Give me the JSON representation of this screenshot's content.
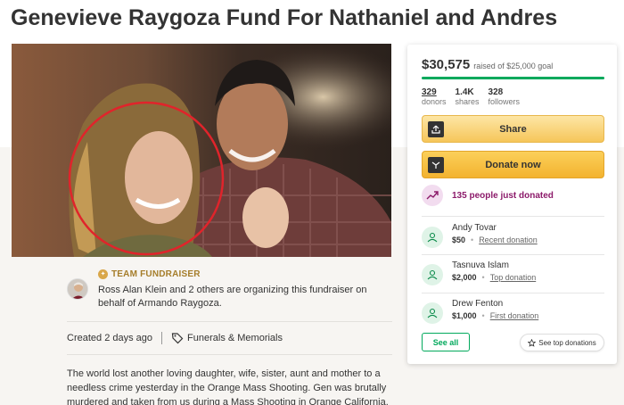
{
  "page": {
    "title": "Genevieve Raygoza Fund For Nathaniel and Andres"
  },
  "organizer": {
    "badge": "TEAM FUNDRAISER",
    "text": "Ross Alan Klein and 2 others are organizing this fundraiser on behalf of Armando Raygoza."
  },
  "meta": {
    "created": "Created 2 days ago",
    "category": "Funerals & Memorials"
  },
  "story": {
    "text": "The world lost another loving  daughter, wife, sister, aunt and mother to a needless crime yesterday in the Orange Mass Shooting.  Gen was brutally  murdered and taken from us during a Mass Shooting in Orange California. Her light has been tragically"
  },
  "card": {
    "raised": "$30,575",
    "goal_text": "raised of $25,000 goal",
    "progress_fraction": 1.0,
    "stats": [
      {
        "num": "329",
        "label": "donors"
      },
      {
        "num": "1.4K",
        "label": "shares"
      },
      {
        "num": "328",
        "label": "followers"
      }
    ],
    "share_label": "Share",
    "donate_label": "Donate now",
    "recent_text": "135 people just donated",
    "donors": [
      {
        "name": "Andy Tovar",
        "amount": "$50",
        "type": "Recent donation"
      },
      {
        "name": "Tasnuva Islam",
        "amount": "$2,000",
        "type": "Top donation"
      },
      {
        "name": "Drew Fenton",
        "amount": "$1,000",
        "type": "First donation"
      }
    ],
    "see_all_label": "See all",
    "see_top_label": "See top donations"
  },
  "colors": {
    "brand_green": "#02a95c",
    "donate_yellow": "#f3b32f",
    "recent_purple": "#8c1a6a",
    "highlight_circle": "#e0242b"
  },
  "icons": {
    "share": "upload-icon",
    "donate": "donate-icon",
    "trend": "trend-up-icon",
    "donor": "heart-hand-icon",
    "tag": "tag-icon",
    "star": "star-icon"
  }
}
